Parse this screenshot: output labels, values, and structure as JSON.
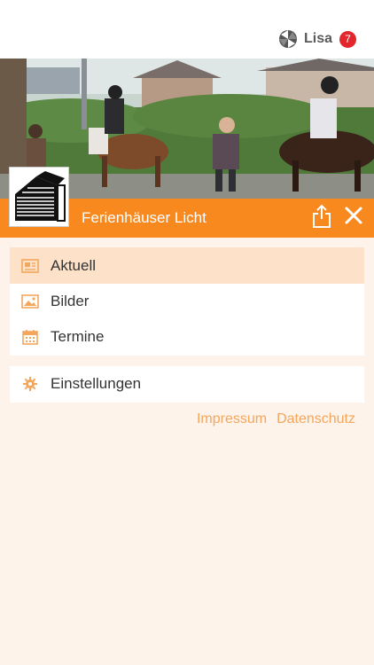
{
  "header": {
    "user_name": "Lisa",
    "badge_count": "7"
  },
  "app": {
    "title": "Ferienhäuser Licht"
  },
  "menu": {
    "items": [
      {
        "label": "Aktuell",
        "icon": "newspaper-icon"
      },
      {
        "label": "Bilder",
        "icon": "image-icon"
      },
      {
        "label": "Termine",
        "icon": "calendar-icon"
      }
    ],
    "settings": {
      "label": "Einstellungen",
      "icon": "gear-icon"
    }
  },
  "footer": {
    "impressum": "Impressum",
    "datenschutz": "Datenschutz"
  },
  "colors": {
    "accent": "#f7891f",
    "icon": "#f3a65c",
    "active_bg": "#fde1c8",
    "background": "#fdf3ea",
    "badge": "#e2262b"
  }
}
